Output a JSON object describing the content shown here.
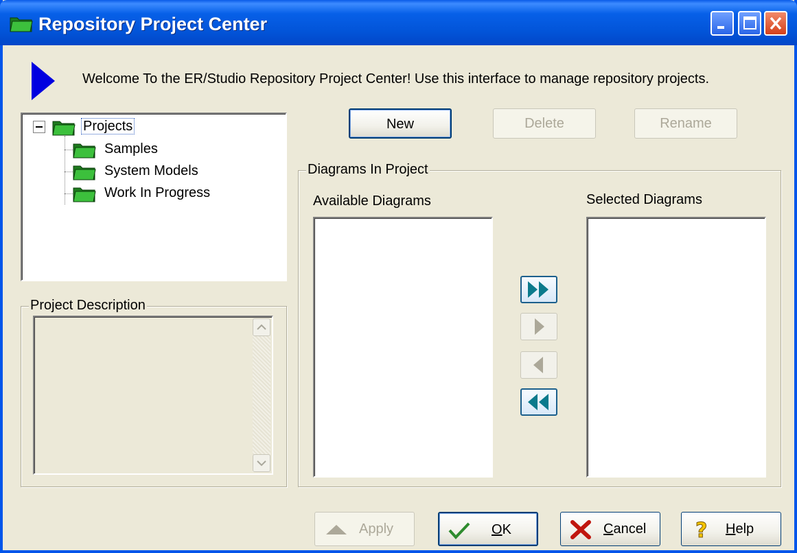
{
  "window": {
    "title": "Repository Project Center",
    "controls": [
      "minimize",
      "maximize",
      "close"
    ]
  },
  "welcome": {
    "icon": "blue-triangle-arrow-icon",
    "text": "Welcome To the ER/Studio Repository Project Center! Use this interface to manage repository projects."
  },
  "tree": {
    "root": {
      "label": "Projects",
      "expanded": true,
      "selected": true
    },
    "children": [
      {
        "label": "Samples"
      },
      {
        "label": "System Models"
      },
      {
        "label": "Work In Progress"
      }
    ]
  },
  "project_description": {
    "label": "Project Description",
    "value": ""
  },
  "toolbar": {
    "new_label": "New",
    "delete_label": "Delete",
    "rename_label": "Rename"
  },
  "diagrams": {
    "group_label": "Diagrams In Project",
    "available_label": "Available Diagrams",
    "selected_label": "Selected Diagrams",
    "available_items": [],
    "selected_items": [],
    "move_buttons": [
      {
        "name": "add-all",
        "enabled": true
      },
      {
        "name": "add-one",
        "enabled": false
      },
      {
        "name": "remove-one",
        "enabled": false
      },
      {
        "name": "remove-all",
        "enabled": true
      }
    ]
  },
  "footer": {
    "apply_label": "Apply",
    "ok_prefix": "",
    "ok_key": "O",
    "ok_rest": "K",
    "cancel_key": "C",
    "cancel_rest": "ancel",
    "help_key": "H",
    "help_rest": "elp"
  },
  "colors": {
    "titlebar": "#0054E3",
    "dialog_bg": "#ECE9D8",
    "arrow_blue": "#0000E0",
    "folder_green": "#2E9E2E",
    "move_arrow_teal": "#0A7A8C"
  }
}
